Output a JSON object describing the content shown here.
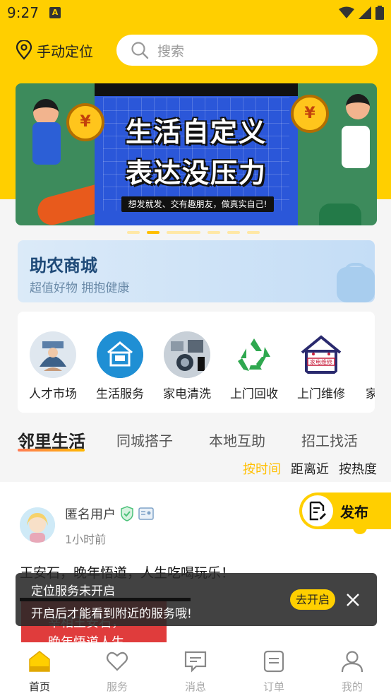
{
  "status_bar": {
    "time": "9:27",
    "notification_icon": "A"
  },
  "header": {
    "location_label": "手动定位",
    "search_placeholder": "搜索"
  },
  "banner": {
    "line1": "生活自定义",
    "line2": "表达没压力",
    "caption": "想发就发、交有趣朋友，做真实自己!",
    "coin_symbol": "¥",
    "page_count": 6,
    "active_index": 1
  },
  "promo": {
    "title": "助农商城",
    "subtitle": "超值好物  拥抱健康"
  },
  "services": [
    {
      "label": "人才市场",
      "icon": "talent-market-icon"
    },
    {
      "label": "生活服务",
      "icon": "life-service-icon"
    },
    {
      "label": "家电清洗",
      "icon": "appliance-cleaning-icon"
    },
    {
      "label": "上门回收",
      "icon": "recycle-icon"
    },
    {
      "label": "上门维修",
      "icon": "home-repair-icon"
    },
    {
      "label": "家",
      "icon": "partial-service-icon"
    }
  ],
  "tabs": [
    {
      "label": "邻里生活",
      "active": true
    },
    {
      "label": "同城搭子",
      "active": false
    },
    {
      "label": "本地互助",
      "active": false
    },
    {
      "label": "招工找活",
      "active": false
    }
  ],
  "sort_options": [
    {
      "label": "按时间",
      "active": true
    },
    {
      "label": "距离近",
      "active": false
    },
    {
      "label": "按热度",
      "active": false
    }
  ],
  "post": {
    "user": "匿名用户",
    "time": "1小时前",
    "text": "王安石，晚年悟道，人生吃喝玩乐！",
    "image_line1": "宰相王安石，",
    "image_line2": "晚年悟道人生"
  },
  "publish_label": "发布",
  "toast": {
    "title": "定位服务未开启",
    "message": "开启后才能看到附近的服务哦!",
    "button": "去开启"
  },
  "bottom_nav": [
    {
      "label": "首页",
      "icon": "home-icon",
      "active": true
    },
    {
      "label": "服务",
      "icon": "heart-icon",
      "active": false
    },
    {
      "label": "消息",
      "icon": "message-icon",
      "active": false
    },
    {
      "label": "订单",
      "icon": "order-icon",
      "active": false
    },
    {
      "label": "我的",
      "icon": "profile-icon",
      "active": false
    }
  ],
  "colors": {
    "brand_yellow": "#ffcf00",
    "active_sort": "#ffbf00",
    "promo_title": "#1f4a78"
  }
}
